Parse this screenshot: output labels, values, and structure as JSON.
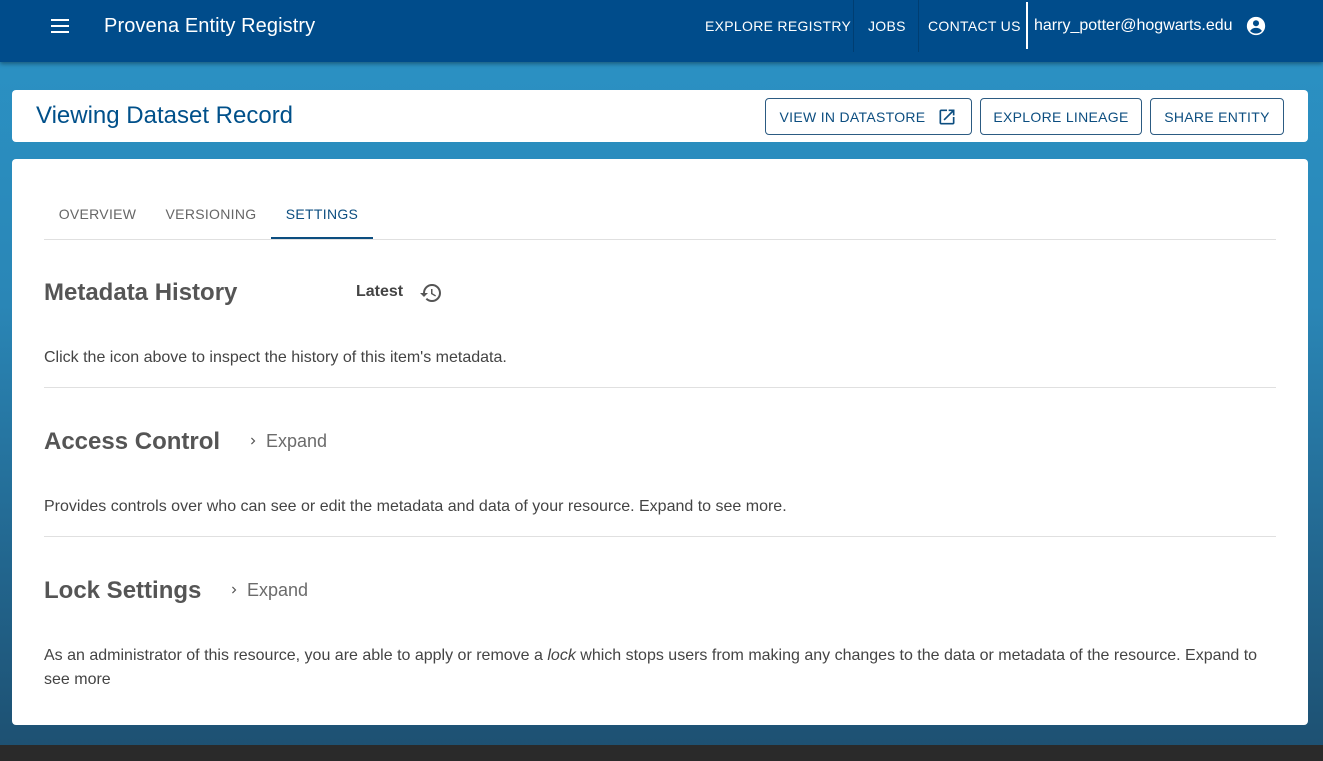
{
  "app": {
    "title": "Provena Entity Registry",
    "nav": {
      "explore_registry": "EXPLORE REGISTRY",
      "jobs": "JOBS",
      "contact_us": "CONTACT US"
    },
    "user_email": "harry_potter@hogwarts.edu",
    "icons": {
      "menu": "menu-icon",
      "account": "account-circle-icon"
    }
  },
  "header": {
    "title": "Viewing Dataset Record",
    "buttons": {
      "view_in_datastore": "VIEW IN DATASTORE",
      "explore_lineage": "EXPLORE LINEAGE",
      "share_entity": "SHARE ENTITY"
    }
  },
  "tabs": {
    "overview": "OVERVIEW",
    "versioning": "VERSIONING",
    "settings": "SETTINGS",
    "active": "SETTINGS"
  },
  "sections": {
    "metadata_history": {
      "title": "Metadata History",
      "latest_label": "Latest",
      "description": "Click the icon above to inspect the history of this item's metadata."
    },
    "access_control": {
      "title": "Access Control",
      "expand_label": "Expand",
      "description": "Provides controls over who can see or edit the metadata and data of your resource. Expand to see more."
    },
    "lock_settings": {
      "title": "Lock Settings",
      "expand_label": "Expand",
      "description_before": "As an administrator of this resource, you are able to apply or remove a ",
      "description_emphasis": "lock",
      "description_after": " which stops users from making any changes to the data or metadata of the resource. Expand to see more"
    }
  },
  "colors": {
    "appbar": "#004c8b",
    "accent": "#0c4e80",
    "title_blue": "#00508a",
    "background_top": "#2b93c6",
    "background_bottom": "#1d4f70"
  }
}
